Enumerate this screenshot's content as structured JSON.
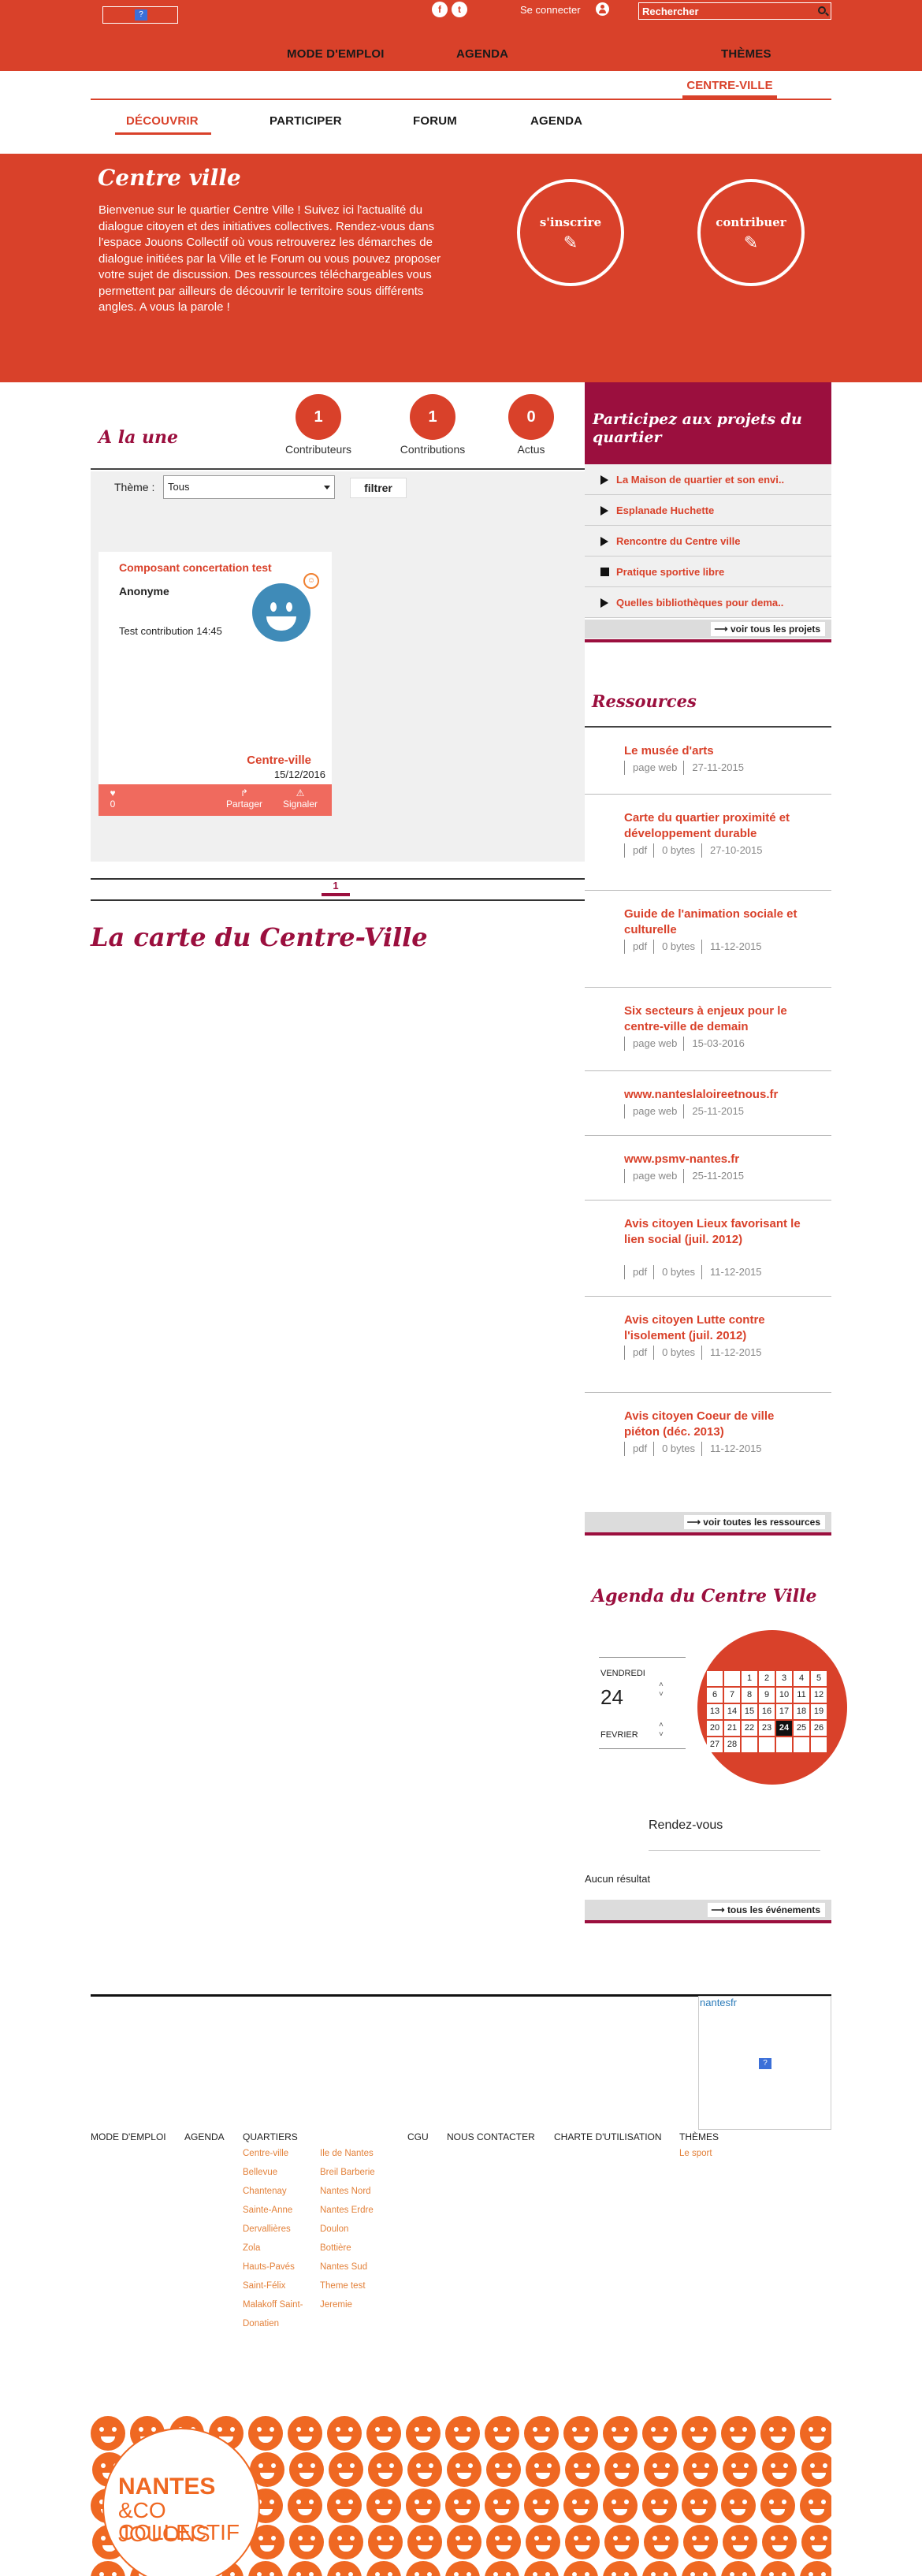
{
  "header": {
    "logo_icon": "image-placeholder-icon",
    "social": [
      "f",
      "t"
    ],
    "connect_label": "Se connecter",
    "search_placeholder": "Rechercher",
    "nav": [
      "MODE D'EMPLOI",
      "AGENDA",
      "THÈMES"
    ],
    "current_district": "CENTRE-VILLE"
  },
  "subnav": [
    "DÉCOUVRIR",
    "PARTICIPER",
    "FORUM",
    "AGENDA"
  ],
  "hero": {
    "title": "Centre ville",
    "text": "Bienvenue sur le quartier Centre Ville ! Suivez ici l'actualité du dialogue citoyen et des initiatives collectives. Rendez-vous dans l'espace Jouons Collectif où vous retrouverez les démarches de dialogue initiées par la Ville et le Forum ou vous pouvez proposer votre sujet de discussion. Des ressources téléchargeables vous permettent par ailleurs de découvrir le territoire sous différents angles. A vous la parole !",
    "subscribe_label": "s'inscrire",
    "contribute_label": "contribuer"
  },
  "alaune": {
    "title": "A la une",
    "stats": [
      {
        "value": "1",
        "label": "Contributeurs"
      },
      {
        "value": "1",
        "label": "Contributions"
      },
      {
        "value": "0",
        "label": "Actus"
      }
    ],
    "theme_label": "Thème :",
    "theme_value": "Tous",
    "filter_label": "filtrer"
  },
  "card": {
    "title": "Composant concertation test",
    "author": "Anonyme",
    "body": "Test contribution 14:45",
    "place": "Centre-ville",
    "date": "15/12/2016",
    "likes": "0",
    "share_label": "Partager",
    "report_label": "Signaler"
  },
  "pagination": {
    "current": "1"
  },
  "map_title": "La carte du Centre-Ville",
  "participez": {
    "title": "Participez aux projets du quartier",
    "projects": [
      "La Maison de quartier et son envi..",
      "Esplanade Huchette",
      "Rencontre du Centre ville",
      "Pratique sportive libre",
      "Quelles bibliothèques pour dema.."
    ],
    "see_all": "voir tous les projets"
  },
  "ressources": {
    "title": "Ressources",
    "items": [
      {
        "title": "Le musée d'arts",
        "meta": [
          "page web",
          "27-11-2015"
        ]
      },
      {
        "title": "Carte du quartier proximité et développement durable",
        "meta": [
          "pdf",
          "0 bytes",
          "27-10-2015"
        ]
      },
      {
        "title": "Guide de l'animation sociale et culturelle",
        "meta": [
          "pdf",
          "0 bytes",
          "11-12-2015"
        ]
      },
      {
        "title": "Six secteurs à enjeux pour le centre-ville de demain",
        "meta": [
          "page web",
          "15-03-2016"
        ]
      },
      {
        "title": "www.nanteslaloireetnous.fr",
        "meta": [
          "page web",
          "25-11-2015"
        ]
      },
      {
        "title": "www.psmv-nantes.fr",
        "meta": [
          "page web",
          "25-11-2015"
        ]
      },
      {
        "title": "Avis citoyen Lieux favorisant le lien social (juil. 2012)",
        "meta": [
          "pdf",
          "0 bytes",
          "11-12-2015"
        ]
      },
      {
        "title": "Avis citoyen Lutte contre l'isolement (juil. 2012)",
        "meta": [
          "pdf",
          "0 bytes",
          "11-12-2015"
        ]
      },
      {
        "title": "Avis citoyen Coeur de ville piéton (déc. 2013)",
        "meta": [
          "pdf",
          "0 bytes",
          "11-12-2015"
        ]
      }
    ],
    "see_all": "voir toutes les ressources"
  },
  "agenda": {
    "title": "Agenda du Centre Ville",
    "day_name": "VENDREDI",
    "day": "24",
    "month": "FEVRIER",
    "calendar": [
      "",
      "",
      "1",
      "2",
      "3",
      "4",
      "5",
      "6",
      "7",
      "8",
      "9",
      "10",
      "11",
      "12",
      "13",
      "14",
      "15",
      "16",
      "17",
      "18",
      "19",
      "20",
      "21",
      "22",
      "23",
      "24",
      "25",
      "26",
      "27",
      "28",
      "",
      "",
      "",
      "",
      ""
    ],
    "today": "24",
    "rdv_label": "Rendez-vous",
    "no_result": "Aucun résultat",
    "see_all": "tous les événements"
  },
  "footer": {
    "nantesfr_label": "nantesfr",
    "columns": [
      "MODE D'EMPLOI",
      "AGENDA",
      "QUARTIERS",
      "CGU",
      "NOUS CONTACTER",
      "CHARTE D'UTILISATION",
      "THÈMES"
    ],
    "quartiers_a": [
      "Centre-ville",
      "Bellevue",
      "Chantenay",
      "Sainte-Anne",
      "Dervallières",
      "Zola",
      "Hauts-Pavés",
      "Saint-Félix",
      "Malakoff Saint-Donatien"
    ],
    "quartiers_b": [
      "Ile de Nantes",
      "Breil Barberie",
      "Nantes Nord",
      "Nantes Erdre",
      "Doulon",
      "Bottière",
      "Nantes Sud",
      "Theme test",
      "Jeremie"
    ],
    "themes": [
      "Le sport"
    ],
    "logo": {
      "line1": "NANTES",
      "line2": "&CO JOUONS",
      "line3": "COLLECTIF"
    }
  },
  "colors": {
    "brand": "#d9412a",
    "accent": "#9b0f3e",
    "footer_link": "#e3813a",
    "mosaic": "#ef6822"
  }
}
